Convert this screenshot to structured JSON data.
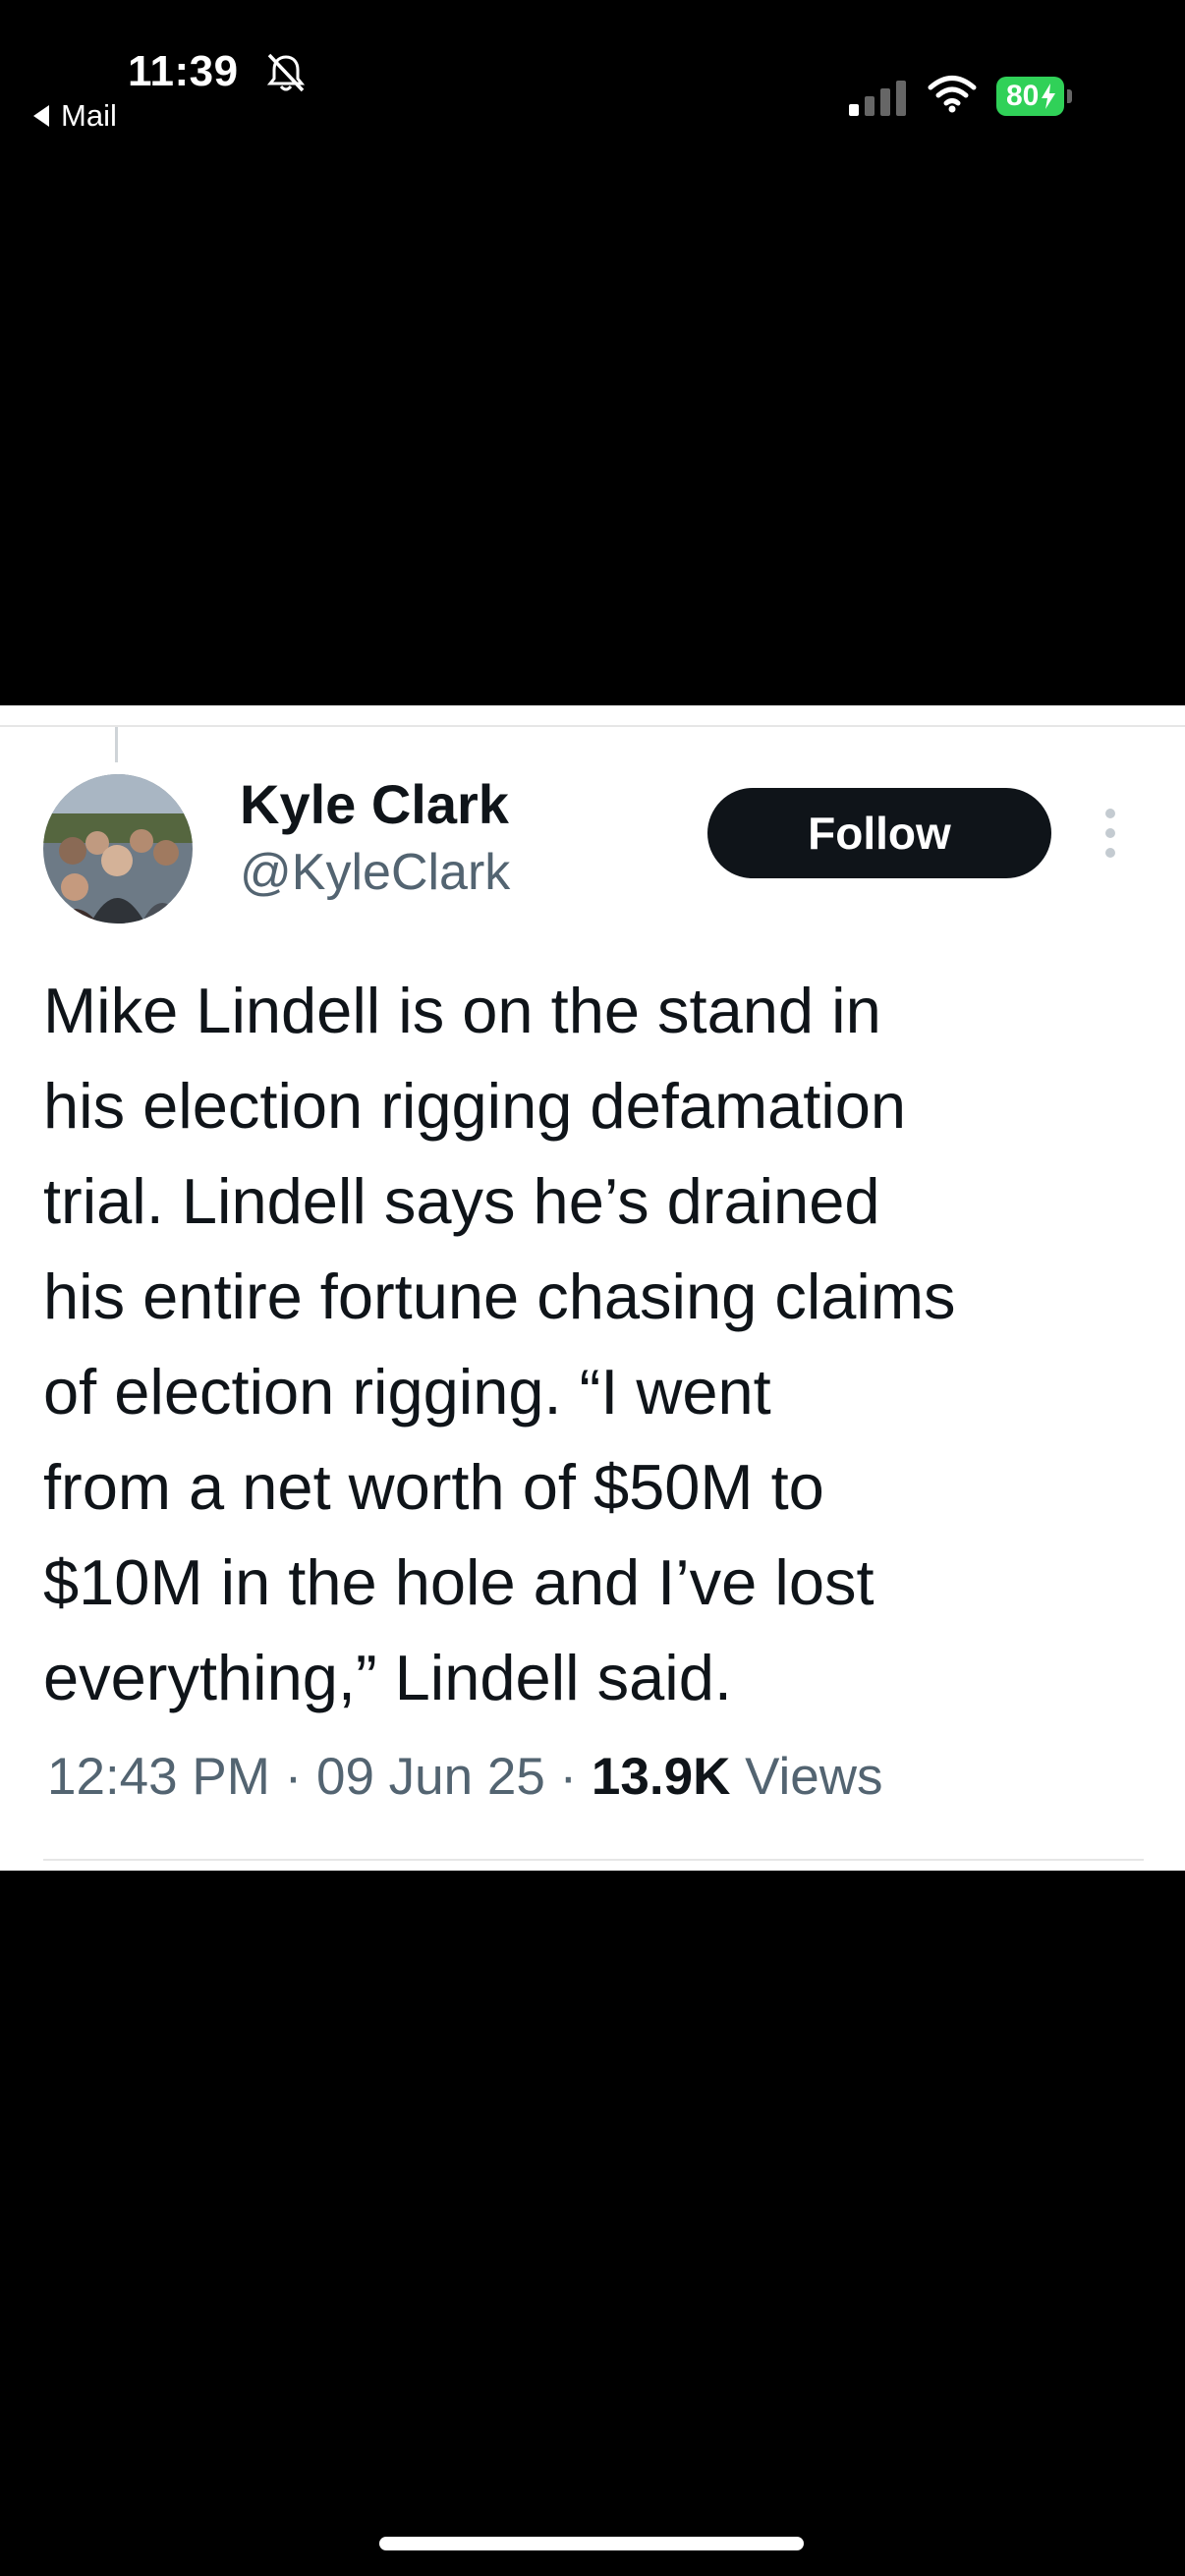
{
  "status_bar": {
    "time": "11:39",
    "back_label": "Mail",
    "battery_level": "80",
    "battery_color": "#30d158",
    "icons": [
      "bell-slash-icon",
      "cellular-signal-icon",
      "wifi-icon",
      "battery-charging-icon"
    ]
  },
  "tweet": {
    "display_name": "Kyle Clark",
    "handle": "@KyleClark",
    "follow_label": "Follow",
    "text_lines": [
      "Mike Lindell is on the stand in",
      "his election rigging defamation",
      "trial. Lindell says he’s drained",
      "his entire fortune chasing claims",
      "of election rigging. “I went",
      "from a net worth of $50M to",
      "$10M in the hole and I’ve lost",
      "everything,” Lindell said."
    ],
    "time": "12:43 PM",
    "date": "09 Jun 25",
    "views_count": "13.9K",
    "views_label": "Views",
    "separator": "·"
  }
}
